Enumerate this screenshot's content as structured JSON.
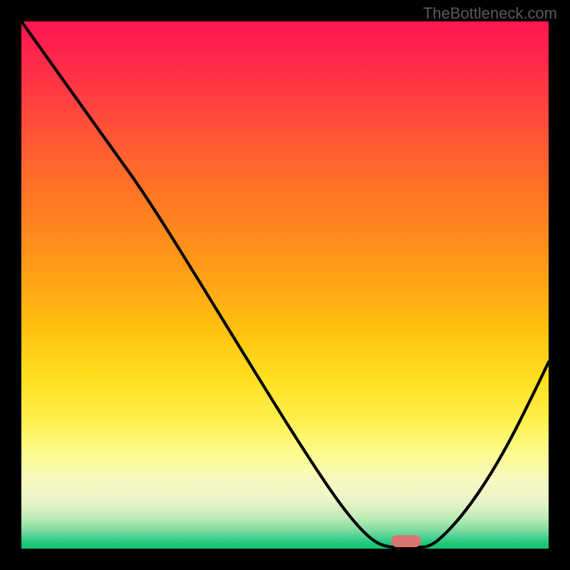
{
  "watermark": "TheBottleneck.com",
  "chart_data": {
    "type": "line",
    "title": "",
    "xlabel": "",
    "ylabel": "",
    "xlim": [
      0,
      100
    ],
    "ylim": [
      0,
      100
    ],
    "x": [
      0,
      15,
      25,
      35,
      45,
      55,
      64,
      68,
      72,
      75,
      80,
      85,
      90,
      95,
      100
    ],
    "values": [
      100,
      80,
      68,
      54,
      40,
      26,
      10,
      3,
      0,
      0,
      2,
      8,
      18,
      30,
      44
    ],
    "gradient_stops": [
      {
        "pos": 0.0,
        "color": "#ff1550"
      },
      {
        "pos": 0.5,
        "color": "#ffa015"
      },
      {
        "pos": 0.82,
        "color": "#fcfc90"
      },
      {
        "pos": 1.0,
        "color": "#18c470"
      }
    ],
    "marker": {
      "x": 73.5,
      "y": 0,
      "color": "#d97570"
    }
  }
}
